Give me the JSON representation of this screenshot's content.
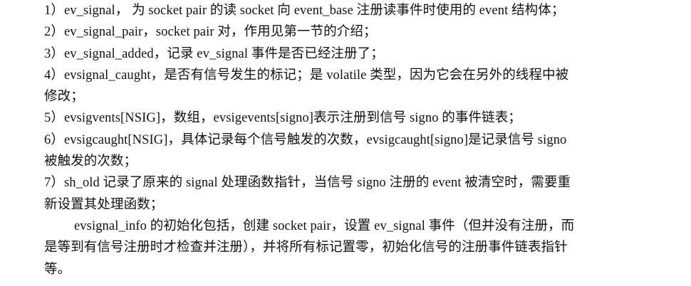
{
  "document": {
    "lines": [
      "1）ev_signal，  为 socket pair 的读 socket 向 event_base 注册读事件时使用的 event 结构体；",
      "2）ev_signal_pair，socket pair 对，作用见第一节的介绍；",
      "3）ev_signal_added，记录 ev_signal 事件是否已经注册了；",
      "4）evsignal_caught，是否有信号发生的标记；是 volatile 类型，因为它会在另外的线程中被",
      "修改；",
      "5）evsigvents[NSIG]，数组，evsigevents[signo]表示注册到信号 signo 的事件链表；",
      "6）evsigcaught[NSIG]，具体记录每个信号触发的次数，evsigcaught[signo]是记录信号  signo",
      "被触发的次数；",
      "7）sh_old 记录了原来的 signal 处理函数指针，当信号 signo 注册的 event 被清空时，需要重",
      "新设置其处理函数；",
      "evsignal_info 的初始化包括，创建 socket pair，设置 ev_signal 事件（但并没有注册，而",
      "是等到有信号注册时才检查并注册），并将所有标记置零，初始化信号的注册事件链表指针",
      "等。"
    ]
  }
}
